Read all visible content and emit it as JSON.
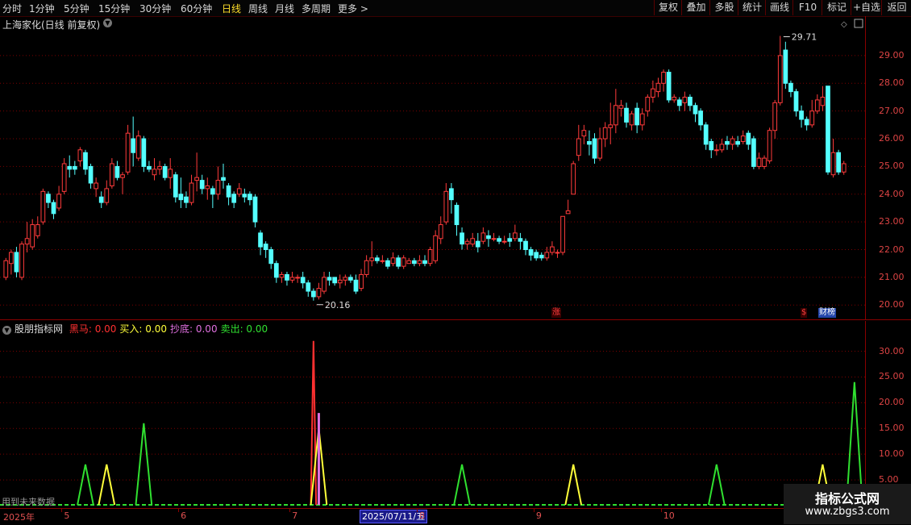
{
  "toolbar": {
    "periods": [
      "分时",
      "1分钟",
      "5分钟",
      "15分钟",
      "30分钟",
      "60分钟",
      "日线",
      "周线",
      "月线",
      "多周期",
      "更多 >"
    ],
    "active_period": "日线",
    "right_buttons": [
      "复权",
      "叠加",
      "多股",
      "统计",
      "画线",
      "F10",
      "标记",
      "+自选",
      "返回"
    ]
  },
  "main": {
    "title": "上海家化(日线 前复权)",
    "high_label": "29.71",
    "low_label": "20.16",
    "badge_zhang": "涨",
    "badge_dollar": "$",
    "badge_caibang": "财榜"
  },
  "indicator": {
    "name": "股朋指标网",
    "items": [
      {
        "label": "黑马:",
        "value": "0.00",
        "color": "#ff3030"
      },
      {
        "label": "买入:",
        "value": "0.00",
        "color": "#ffff3a"
      },
      {
        "label": "抄底:",
        "value": "0.00",
        "color": "#e070e0"
      },
      {
        "label": "卖出:",
        "value": "0.00",
        "color": "#30e030"
      }
    ],
    "future_note": "用到未来数据"
  },
  "date_axis": {
    "year_label": "2025年",
    "months": [
      "5",
      "6",
      "7",
      "8",
      "9",
      "10"
    ],
    "cursor_date": "2025/07/11/五"
  },
  "watermark": {
    "title": "指标公式网",
    "url": "www.zbgs3.com"
  },
  "colors": {
    "up": "#ff3b3b",
    "down": "#54ffff",
    "grid": "#7a0000",
    "axis": "#8a0000"
  },
  "chart_data": [
    {
      "type": "candlestick",
      "title": "上海家化(日线 前复权)",
      "y_axis_ticks": [
        20.0,
        21.0,
        22.0,
        23.0,
        24.0,
        25.0,
        26.0,
        27.0,
        28.0,
        29.0
      ],
      "ylim": [
        19.6,
        29.9
      ],
      "annotations": [
        {
          "label": "29.71",
          "value": 29.71
        },
        {
          "label": "20.16",
          "value": 20.16
        }
      ],
      "candles": [
        [
          21.0,
          21.6,
          20.9,
          21.7
        ],
        [
          21.5,
          21.9,
          21.1,
          22.0
        ],
        [
          21.9,
          21.2,
          21.0,
          22.1
        ],
        [
          21.0,
          22.2,
          20.9,
          22.3
        ],
        [
          22.2,
          22.4,
          21.9,
          23.0
        ],
        [
          22.1,
          22.9,
          22.0,
          23.1
        ],
        [
          22.5,
          22.9,
          22.4,
          23.2
        ],
        [
          23.0,
          24.1,
          22.9,
          24.2
        ],
        [
          24.0,
          23.7,
          23.5,
          24.1
        ],
        [
          23.7,
          23.3,
          23.1,
          23.8
        ],
        [
          23.5,
          24.0,
          23.4,
          24.3
        ],
        [
          24.1,
          25.1,
          24.0,
          25.3
        ],
        [
          25.0,
          24.9,
          24.6,
          25.4
        ],
        [
          25.0,
          24.9,
          24.7,
          25.2
        ],
        [
          25.2,
          25.6,
          25.0,
          25.7
        ],
        [
          25.5,
          24.9,
          24.7,
          25.6
        ],
        [
          25.0,
          24.4,
          24.2,
          25.1
        ],
        [
          24.2,
          24.4,
          23.9,
          24.6
        ],
        [
          23.9,
          23.7,
          23.5,
          24.1
        ],
        [
          23.7,
          24.2,
          23.6,
          24.5
        ],
        [
          24.3,
          25.1,
          24.2,
          25.3
        ],
        [
          25.0,
          24.6,
          24.5,
          25.2
        ],
        [
          24.6,
          24.7,
          24.0,
          24.8
        ],
        [
          24.8,
          26.2,
          24.7,
          26.5
        ],
        [
          26.0,
          25.5,
          25.0,
          26.8
        ],
        [
          25.3,
          26.1,
          25.2,
          26.3
        ],
        [
          26.0,
          25.0,
          24.8,
          26.1
        ],
        [
          25.0,
          24.9,
          24.8,
          25.2
        ],
        [
          24.7,
          24.9,
          24.5,
          25.3
        ],
        [
          24.9,
          25.0,
          24.7,
          25.2
        ],
        [
          25.0,
          24.6,
          24.5,
          25.1
        ],
        [
          24.6,
          24.9,
          24.2,
          25.3
        ],
        [
          24.7,
          23.9,
          23.7,
          24.8
        ],
        [
          24.0,
          23.8,
          23.5,
          24.6
        ],
        [
          23.9,
          23.7,
          23.5,
          24.1
        ],
        [
          23.7,
          24.4,
          23.6,
          24.7
        ],
        [
          24.5,
          24.6,
          24.1,
          25.5
        ],
        [
          24.5,
          24.2,
          24.0,
          24.7
        ],
        [
          24.2,
          24.3,
          23.8,
          24.6
        ],
        [
          24.2,
          24.0,
          23.5,
          24.3
        ],
        [
          24.0,
          24.5,
          23.8,
          25.0
        ],
        [
          24.6,
          24.5,
          24.2,
          25.1
        ],
        [
          24.3,
          23.9,
          23.6,
          24.4
        ],
        [
          24.0,
          23.7,
          23.5,
          24.1
        ],
        [
          24.0,
          24.2,
          23.9,
          24.4
        ],
        [
          24.0,
          23.9,
          23.7,
          24.2
        ],
        [
          24.0,
          23.8,
          23.6,
          24.1
        ],
        [
          23.9,
          23.0,
          22.8,
          24.0
        ],
        [
          22.6,
          22.1,
          21.8,
          22.7
        ],
        [
          22.2,
          22.0,
          21.7,
          22.3
        ],
        [
          22.0,
          21.5,
          21.3,
          22.1
        ],
        [
          21.5,
          21.0,
          20.8,
          21.6
        ],
        [
          21.0,
          21.1,
          20.8,
          21.2
        ],
        [
          21.1,
          20.9,
          20.7,
          21.2
        ],
        [
          20.9,
          21.0,
          20.8,
          21.2
        ],
        [
          21.0,
          21.0,
          20.8,
          21.1
        ],
        [
          21.0,
          20.8,
          20.6,
          21.2
        ],
        [
          20.8,
          20.5,
          20.3,
          20.9
        ],
        [
          20.5,
          20.3,
          20.16,
          20.6
        ],
        [
          20.3,
          20.6,
          20.2,
          20.8
        ],
        [
          20.5,
          21.0,
          20.4,
          21.2
        ],
        [
          21.0,
          20.9,
          20.7,
          21.2
        ],
        [
          21.0,
          20.8,
          20.7,
          21.0
        ],
        [
          20.8,
          20.9,
          20.6,
          21.1
        ],
        [
          20.9,
          21.0,
          20.7,
          21.1
        ],
        [
          21.0,
          20.9,
          20.8,
          21.1
        ],
        [
          20.9,
          20.5,
          20.4,
          21.1
        ],
        [
          20.6,
          21.1,
          20.5,
          21.3
        ],
        [
          21.1,
          21.6,
          21.0,
          21.8
        ],
        [
          21.6,
          21.7,
          21.4,
          22.3
        ],
        [
          21.7,
          21.6,
          21.5,
          21.8
        ],
        [
          21.6,
          21.6,
          21.5,
          21.8
        ],
        [
          21.6,
          21.4,
          21.3,
          21.7
        ],
        [
          21.5,
          21.7,
          21.4,
          21.9
        ],
        [
          21.7,
          21.4,
          21.3,
          21.8
        ],
        [
          21.4,
          21.7,
          21.3,
          21.8
        ],
        [
          21.5,
          21.6,
          21.5,
          21.7
        ],
        [
          21.6,
          21.5,
          21.4,
          21.7
        ],
        [
          21.5,
          21.6,
          21.4,
          21.8
        ],
        [
          21.6,
          21.5,
          21.4,
          21.8
        ],
        [
          21.5,
          22.0,
          21.4,
          22.1
        ],
        [
          21.6,
          22.5,
          21.5,
          22.7
        ],
        [
          22.4,
          22.9,
          22.2,
          23.2
        ],
        [
          23.0,
          24.1,
          22.9,
          24.4
        ],
        [
          24.2,
          23.8,
          23.3,
          24.4
        ],
        [
          23.6,
          22.9,
          22.5,
          23.7
        ],
        [
          22.6,
          22.2,
          22.0,
          22.8
        ],
        [
          22.2,
          22.3,
          22.0,
          22.4
        ],
        [
          22.2,
          22.4,
          22.1,
          22.6
        ],
        [
          22.3,
          22.1,
          21.9,
          22.6
        ],
        [
          22.3,
          22.6,
          22.2,
          22.8
        ],
        [
          22.5,
          22.4,
          22.1,
          22.7
        ],
        [
          22.4,
          22.4,
          22.3,
          22.6
        ],
        [
          22.4,
          22.3,
          22.2,
          22.5
        ],
        [
          22.3,
          22.3,
          22.2,
          22.5
        ],
        [
          22.4,
          22.3,
          22.1,
          22.6
        ],
        [
          22.4,
          22.6,
          22.3,
          22.9
        ],
        [
          22.4,
          22.3,
          22.0,
          22.6
        ],
        [
          22.3,
          22.0,
          21.8,
          22.4
        ],
        [
          22.0,
          21.8,
          21.6,
          22.1
        ],
        [
          21.9,
          21.7,
          21.6,
          22.0
        ],
        [
          21.8,
          21.7,
          21.6,
          21.9
        ],
        [
          21.7,
          21.9,
          21.6,
          22.1
        ],
        [
          21.9,
          22.1,
          21.8,
          22.3
        ],
        [
          21.9,
          21.9,
          21.7,
          22.0
        ],
        [
          21.9,
          23.2,
          21.8,
          23.2
        ],
        [
          23.3,
          23.4,
          23.3,
          23.8
        ],
        [
          24.0,
          25.1,
          24.0,
          25.2
        ],
        [
          25.4,
          26.0,
          25.2,
          26.5
        ],
        [
          26.1,
          26.3,
          25.8,
          26.5
        ],
        [
          25.9,
          25.8,
          25.4,
          26.3
        ],
        [
          26.0,
          25.3,
          25.1,
          26.2
        ],
        [
          25.3,
          26.0,
          25.2,
          26.4
        ],
        [
          26.0,
          26.4,
          25.7,
          26.6
        ],
        [
          26.4,
          26.5,
          25.8,
          27.3
        ],
        [
          26.5,
          27.2,
          26.2,
          27.8
        ],
        [
          27.1,
          27.2,
          26.8,
          27.4
        ],
        [
          27.1,
          26.6,
          26.4,
          27.3
        ],
        [
          26.5,
          26.9,
          26.3,
          27.0
        ],
        [
          27.1,
          26.5,
          26.2,
          27.3
        ],
        [
          26.5,
          26.9,
          26.3,
          27.1
        ],
        [
          27.0,
          27.5,
          26.8,
          27.6
        ],
        [
          27.5,
          27.8,
          27.3,
          28.1
        ],
        [
          27.7,
          28.0,
          27.5,
          28.2
        ],
        [
          28.0,
          28.4,
          27.7,
          28.5
        ],
        [
          28.4,
          27.4,
          27.3,
          28.5
        ],
        [
          27.4,
          27.5,
          27.3,
          27.6
        ],
        [
          27.4,
          27.2,
          27.0,
          27.5
        ],
        [
          27.3,
          27.5,
          27.0,
          27.7
        ],
        [
          27.5,
          27.2,
          27.0,
          27.6
        ],
        [
          27.2,
          26.9,
          26.6,
          27.3
        ],
        [
          27.0,
          26.5,
          26.3,
          27.1
        ],
        [
          26.5,
          25.8,
          25.6,
          26.6
        ],
        [
          25.9,
          25.6,
          25.3,
          26.0
        ],
        [
          25.6,
          25.6,
          25.4,
          25.8
        ],
        [
          25.6,
          25.8,
          25.5,
          26.0
        ],
        [
          25.9,
          25.8,
          25.6,
          26.1
        ],
        [
          25.8,
          26.0,
          25.6,
          26.1
        ],
        [
          25.9,
          25.8,
          25.7,
          26.1
        ],
        [
          25.9,
          26.1,
          25.8,
          26.3
        ],
        [
          26.2,
          25.8,
          25.6,
          26.3
        ],
        [
          26.0,
          25.0,
          24.9,
          26.1
        ],
        [
          25.0,
          25.3,
          24.9,
          25.5
        ],
        [
          25.0,
          25.3,
          24.9,
          25.4
        ],
        [
          25.2,
          26.3,
          25.1,
          26.4
        ],
        [
          26.3,
          27.3,
          26.0,
          27.4
        ],
        [
          27.3,
          29.0,
          27.2,
          29.71
        ],
        [
          29.2,
          28.0,
          27.8,
          29.5
        ],
        [
          28.0,
          27.7,
          27.5,
          28.1
        ],
        [
          27.7,
          27.0,
          26.8,
          27.8
        ],
        [
          27.0,
          26.7,
          26.4,
          27.2
        ],
        [
          26.7,
          26.5,
          26.3,
          26.8
        ],
        [
          26.5,
          27.0,
          26.4,
          27.4
        ],
        [
          27.0,
          27.4,
          26.9,
          27.6
        ],
        [
          27.2,
          27.5,
          27.0,
          27.9
        ],
        [
          27.9,
          24.8,
          24.7,
          27.9
        ],
        [
          24.7,
          25.5,
          24.6,
          26.0
        ],
        [
          25.5,
          24.8,
          24.7,
          25.6
        ],
        [
          24.8,
          25.1,
          24.7,
          25.2
        ]
      ]
    },
    {
      "type": "line",
      "title": "股朋指标网",
      "y_axis_ticks": [
        5.0,
        10.0,
        15.0,
        20.0,
        25.0,
        30.0
      ],
      "ylim": [
        0,
        34
      ],
      "series": [
        {
          "name": "黑马",
          "color": "#ff3030",
          "peaks": [
            {
              "index": 58,
              "value": 32
            }
          ]
        },
        {
          "name": "买入",
          "color": "#ffff3a",
          "peaks": [
            {
              "index": 19,
              "value": 8
            },
            {
              "index": 59,
              "value": 15
            },
            {
              "index": 107,
              "value": 8
            },
            {
              "index": 154,
              "value": 8
            },
            {
              "index": 172,
              "value": 8
            }
          ]
        },
        {
          "name": "抄底",
          "color": "#e070e0",
          "peaks": [
            {
              "index": 59,
              "value": 18
            }
          ]
        },
        {
          "name": "卖出",
          "color": "#30e030",
          "peaks": [
            {
              "index": 15,
              "value": 8
            },
            {
              "index": 26,
              "value": 16
            },
            {
              "index": 86,
              "value": 8
            },
            {
              "index": 134,
              "value": 8
            },
            {
              "index": 160,
              "value": 24
            }
          ]
        }
      ],
      "baseline": [
        {
          "name": "卖出",
          "value": 0
        }
      ]
    }
  ]
}
